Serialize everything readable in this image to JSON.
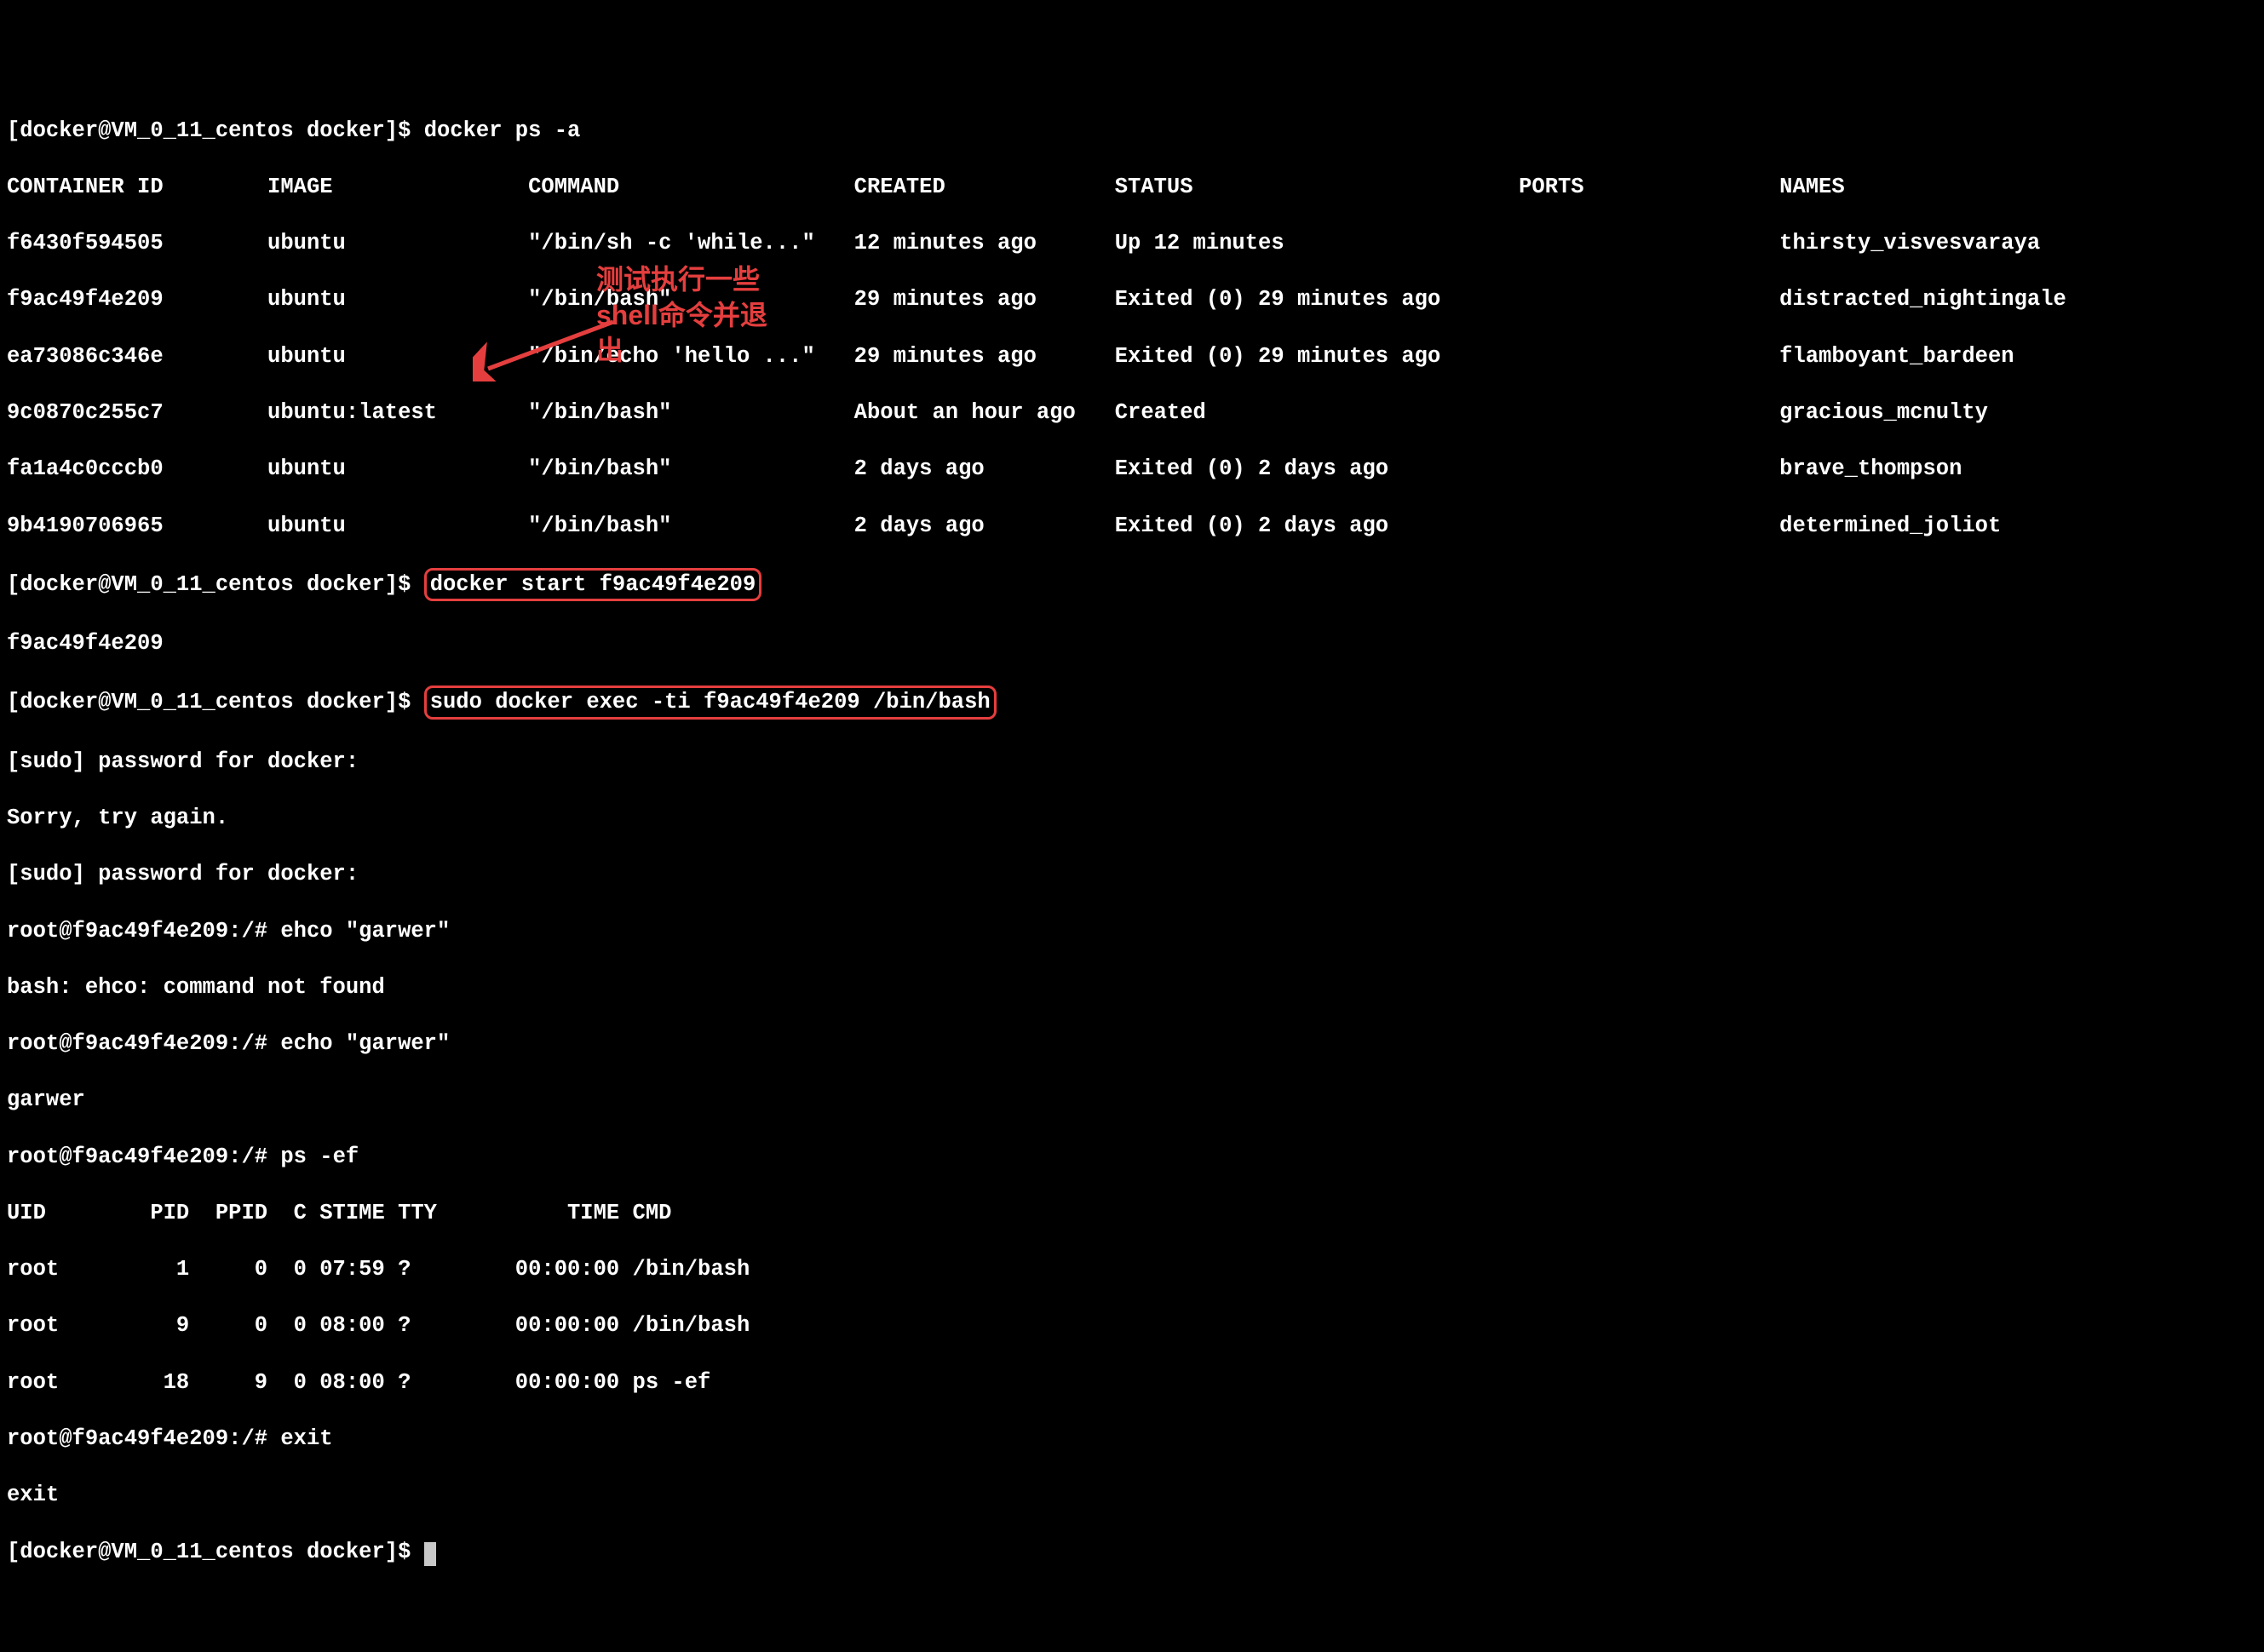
{
  "prompt_host": "[docker@VM_0_11_centos docker]$ ",
  "prompt_container": "root@f9ac49f4e209:/# ",
  "cmds": {
    "ps_a": "docker ps -a",
    "start": "docker start f9ac49f4e209",
    "exec": "sudo docker exec -ti f9ac49f4e209 /bin/bash",
    "ehco": "ehco \"garwer\"",
    "echo": "echo \"garwer\"",
    "ps_ef": "ps -ef",
    "exit": "exit"
  },
  "table_header": "CONTAINER ID        IMAGE               COMMAND                  CREATED             STATUS                         PORTS               NAMES",
  "rows": [
    "f6430f594505        ubuntu              \"/bin/sh -c 'while...\"   12 minutes ago      Up 12 minutes                                      thirsty_visvesvaraya",
    "f9ac49f4e209        ubuntu              \"/bin/bash\"              29 minutes ago      Exited (0) 29 minutes ago                          distracted_nightingale",
    "ea73086c346e        ubuntu              \"/bin/echo 'hello ...\"   29 minutes ago      Exited (0) 29 minutes ago                          flamboyant_bardeen",
    "9c0870c255c7        ubuntu:latest       \"/bin/bash\"              About an hour ago   Created                                            gracious_mcnulty",
    "fa1a4c0cccb0        ubuntu              \"/bin/bash\"              2 days ago          Exited (0) 2 days ago                              brave_thompson",
    "9b4190706965        ubuntu              \"/bin/bash\"              2 days ago          Exited (0) 2 days ago                              determined_joliot"
  ],
  "start_output": "f9ac49f4e209",
  "sudo_prompt": "[sudo] password for docker:",
  "sorry": "Sorry, try again.",
  "bash_err": "bash: ehco: command not found",
  "echo_output": "garwer",
  "ps_header": "UID        PID  PPID  C STIME TTY          TIME CMD",
  "ps_rows": [
    "root         1     0  0 07:59 ?        00:00:00 /bin/bash",
    "root         9     0  0 08:00 ?        00:00:00 /bin/bash",
    "root        18     9  0 08:00 ?        00:00:00 ps -ef"
  ],
  "exit_output": "exit",
  "annotation": "测试执行一些shell命令并退出",
  "colors": {
    "highlight_border": "#e53e3e",
    "annotation_text": "#e53e3e",
    "bg": "#000000",
    "fg": "#ffffff"
  }
}
